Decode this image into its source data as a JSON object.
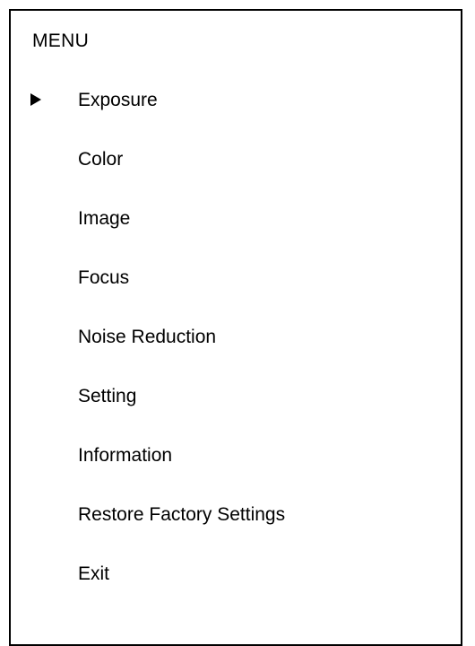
{
  "menu": {
    "title": "MENU",
    "selected_index": 0,
    "selector_icon": "triangle-right-icon",
    "items": [
      {
        "label": "Exposure"
      },
      {
        "label": "Color"
      },
      {
        "label": "Image"
      },
      {
        "label": "Focus"
      },
      {
        "label": "Noise Reduction"
      },
      {
        "label": "Setting"
      },
      {
        "label": "Information"
      },
      {
        "label": "Restore Factory Settings"
      },
      {
        "label": "Exit"
      }
    ]
  }
}
